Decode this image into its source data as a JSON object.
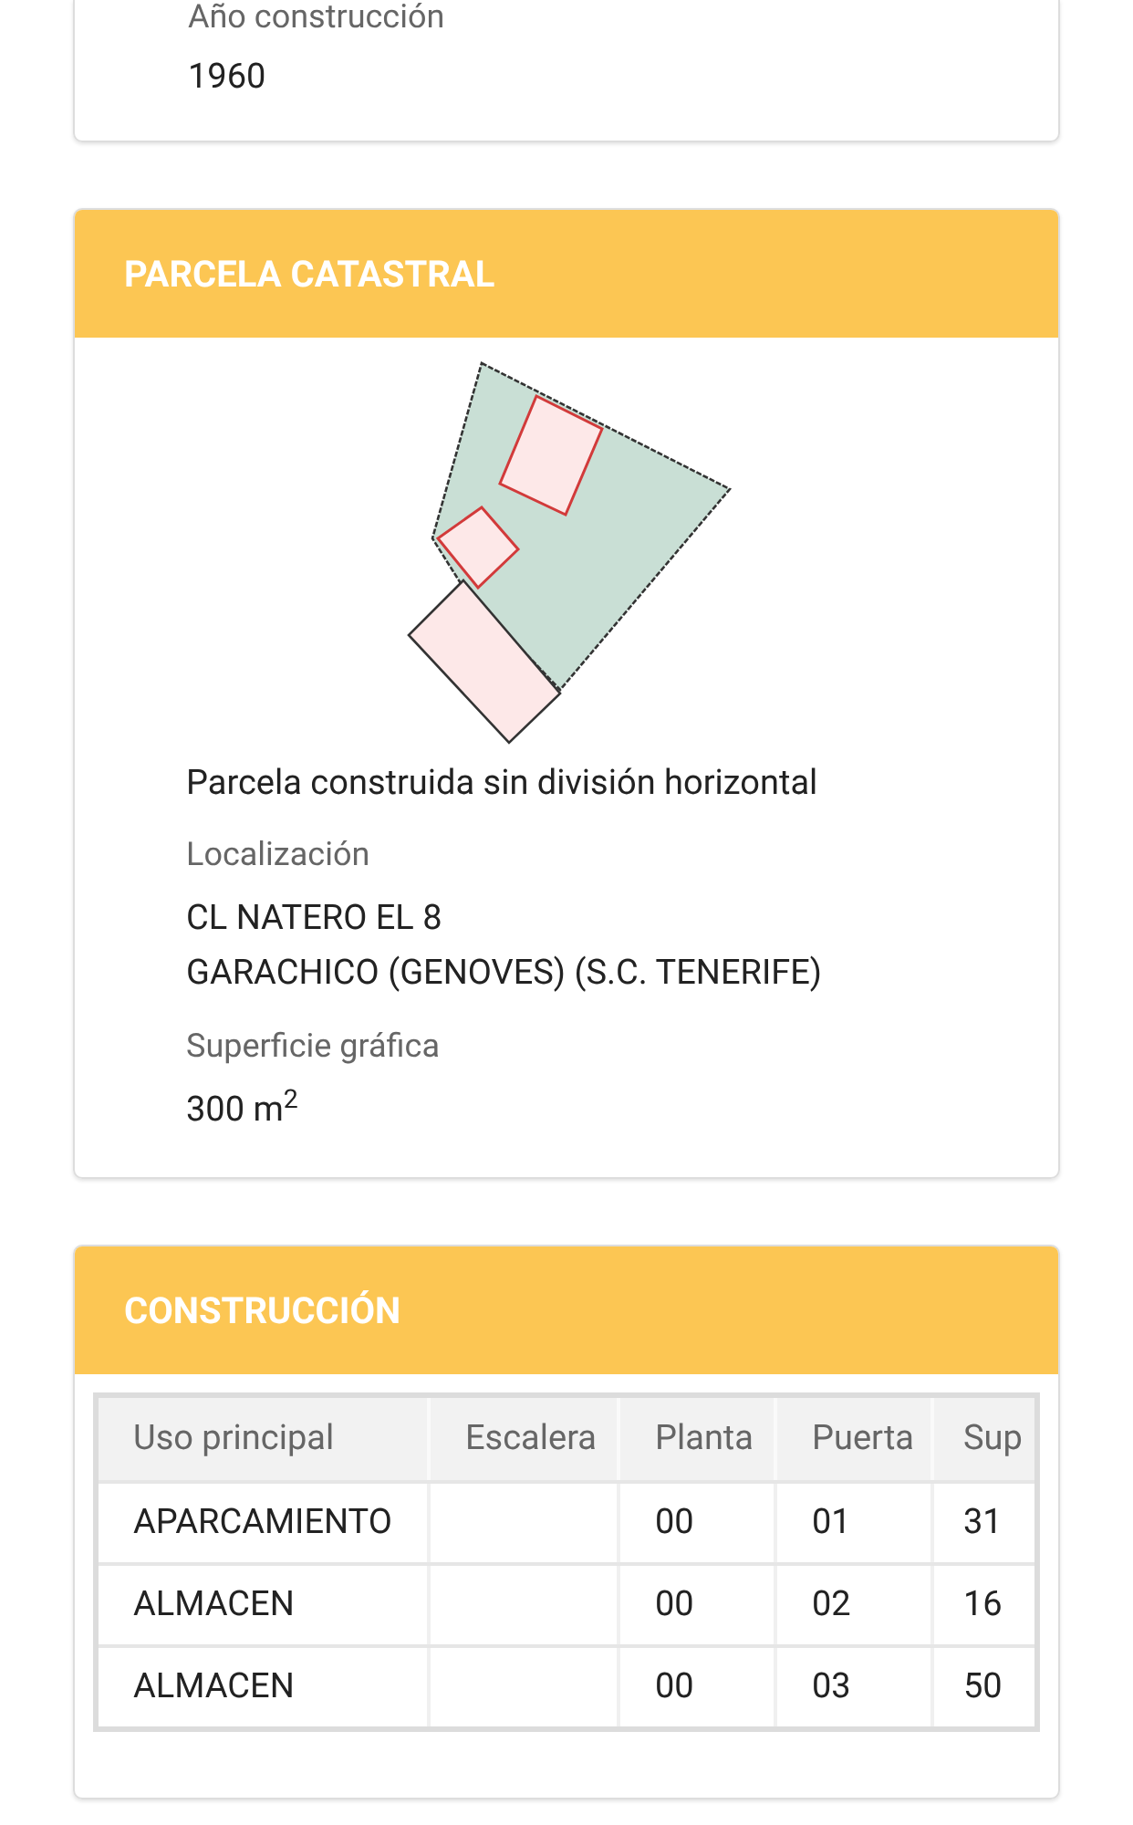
{
  "top_card": {
    "label": "Año construcción",
    "value": "1960"
  },
  "parcela": {
    "title": "PARCELA CATASTRAL",
    "description": "Parcela construida sin división horizontal",
    "fields": [
      {
        "label": "Localización",
        "lines": [
          "CL NATERO EL 8",
          "GARACHICO (GENOVES) (S.C. TENERIFE)"
        ]
      },
      {
        "label": "Superficie gráfica",
        "lines": [
          "300 m$^{2}$"
        ]
      }
    ]
  },
  "construccion": {
    "title": "CONSTRUCCIÓN",
    "columns": [
      "Uso principal",
      "Escalera",
      "Planta",
      "Puerta",
      "Sup"
    ],
    "rows": [
      [
        "APARCAMIENTO",
        "",
        "00",
        "01",
        "31"
      ],
      [
        "ALMACEN",
        "",
        "00",
        "02",
        "16"
      ],
      [
        "ALMACEN",
        "",
        "00",
        "03",
        "50"
      ]
    ]
  }
}
